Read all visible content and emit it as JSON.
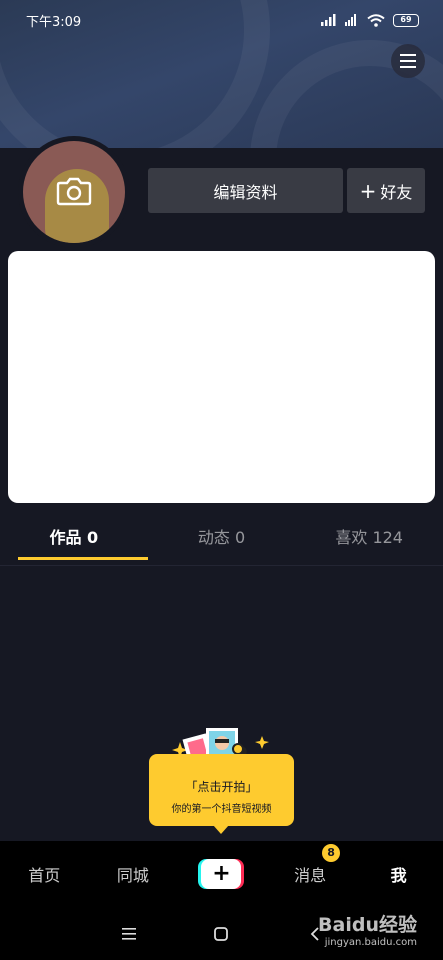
{
  "status_bar": {
    "time": "下午3:09",
    "battery": "69"
  },
  "profile": {
    "edit_label": "编辑资料",
    "add_friend_label": "好友",
    "add_friend_prefix": "+"
  },
  "tabs": [
    {
      "label": "作品 0",
      "active": true
    },
    {
      "label": "动态 0",
      "active": false
    },
    {
      "label": "喜欢 124",
      "active": false
    }
  ],
  "prompt": {
    "title": "「点击开拍」",
    "subtitle": "你的第一个抖音短视频"
  },
  "bottom_nav": {
    "home": "首页",
    "nearby": "同城",
    "plus": "+",
    "messages": "消息",
    "messages_badge": "8",
    "me": "我"
  },
  "watermark": {
    "brand": "Baidu经验",
    "url": "jingyan.baidu.com"
  },
  "colors": {
    "accent": "#fecb2f",
    "background": "#161823",
    "button": "#393b44",
    "cyan": "#25f4ee",
    "red": "#fe2c55"
  }
}
